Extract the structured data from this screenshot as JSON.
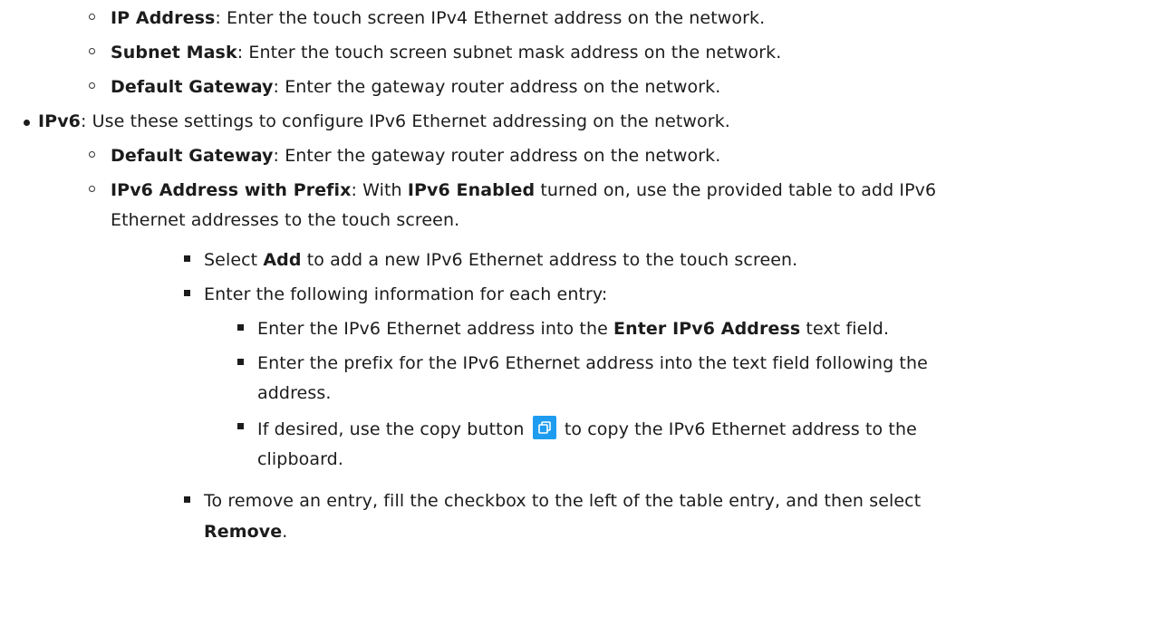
{
  "items": {
    "ip_address": {
      "term": "IP Address",
      "text": ": Enter the touch screen IPv4 Ethernet address on the network."
    },
    "subnet_mask": {
      "term": "Subnet Mask",
      "text": ": Enter the touch screen subnet mask address on the network."
    },
    "default_gateway_v4": {
      "term": "Default Gateway",
      "text": ": Enter the gateway router address on the network."
    },
    "ipv6": {
      "term": "IPv6",
      "text": ": Use these settings to configure IPv6 Ethernet addressing on the network."
    },
    "default_gateway_v6": {
      "term": "Default Gateway",
      "text": ": Enter the gateway router address on the network."
    },
    "ipv6_prefix": {
      "term": "IPv6 Address with Prefix",
      "text_a": ": With ",
      "term_b": "IPv6 Enabled",
      "text_b": " turned on, use the provided table to add IPv6",
      "line2": "Ethernet addresses to the touch screen."
    },
    "select_add": {
      "pre": "Select ",
      "term": "Add",
      "post": " to add a new IPv6 Ethernet address to the touch screen."
    },
    "enter_info": {
      "text": "Enter the following information for each entry:"
    },
    "enter_address": {
      "pre": "Enter the IPv6 Ethernet address into the ",
      "term": "Enter IPv6 Address",
      "post": " text field."
    },
    "enter_prefix": {
      "line1": "Enter the prefix for the IPv6 Ethernet address into the text field following the",
      "line2": "address."
    },
    "copy": {
      "pre": "If desired, use the copy button",
      "post": "to copy the IPv6 Ethernet address to the",
      "line2": "clipboard."
    },
    "remove": {
      "line1": "To remove an entry, fill the checkbox to the left of the table entry, and then select",
      "term": "Remove",
      "post": "."
    }
  },
  "icons": {
    "copy_button": "copy-icon",
    "copy_button_color": "#1e9cf0"
  }
}
